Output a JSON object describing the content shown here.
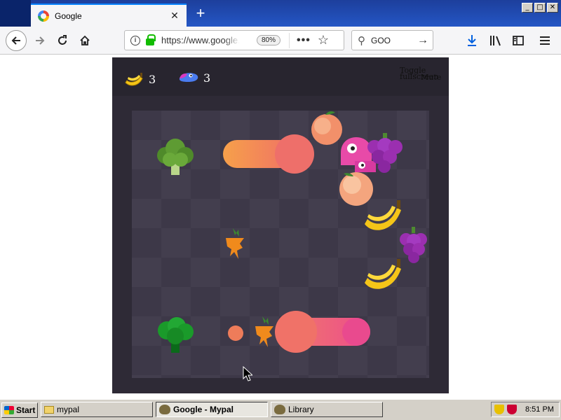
{
  "browser": {
    "tab_title": "Google",
    "tab_close": "✕",
    "new_tab": "+",
    "window_buttons": [
      "_",
      "□",
      "✕"
    ],
    "url": "https://www.google.com",
    "zoom": "80%",
    "page_actions": "•••",
    "search_text": "GOO"
  },
  "game": {
    "bananas_eaten": "3",
    "snake_length": "3",
    "toggle_label": "Toggle fullscreen",
    "mute_label": "Mute"
  },
  "taskbar": {
    "start_label": "Start",
    "tasks": [
      "mypal",
      "Google - Mypal",
      "Library"
    ],
    "clock": "8:51 PM"
  },
  "colors": {
    "snake_orange": "#f6a04a",
    "snake_pink": "#ef4d8a",
    "board_dark": "#3d3848",
    "board_light": "#433e4e"
  }
}
